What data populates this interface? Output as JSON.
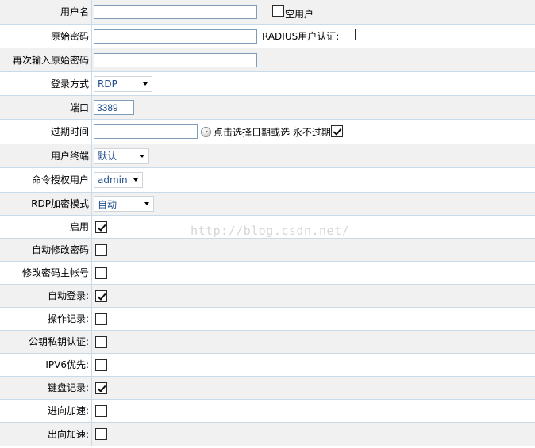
{
  "form": {
    "username": {
      "label": "用户名",
      "value": "",
      "empty_user_label": "空用户",
      "empty_user_checked": false
    },
    "orig_password": {
      "label": "原始密码",
      "value": "",
      "radius_label": "RADIUS用户认证:",
      "radius_checked": false
    },
    "confirm_password": {
      "label": "再次输入原始密码",
      "value": ""
    },
    "login_method": {
      "label": "登录方式",
      "selected": "RDP"
    },
    "port": {
      "label": "端口",
      "value": "3389"
    },
    "expire": {
      "label": "过期时间",
      "value": "",
      "hint": "点击选择日期或选 永不过期",
      "never_checked": true
    },
    "terminal": {
      "label": "用户终端",
      "selected": "默认"
    },
    "cmd_user": {
      "label": "命令授权用户",
      "selected": "admin"
    },
    "rdp_encrypt": {
      "label": "RDP加密模式",
      "selected": "自动"
    },
    "checks": [
      {
        "label": "启用",
        "checked": true
      },
      {
        "label": "自动修改密码",
        "checked": false
      },
      {
        "label": "修改密码主帐号",
        "checked": false
      },
      {
        "label": "自动登录:",
        "checked": true
      },
      {
        "label": "操作记录:",
        "checked": false
      },
      {
        "label": "公钥私钥认证:",
        "checked": false
      },
      {
        "label": "IPV6优先:",
        "checked": false
      },
      {
        "label": "键盘记录:",
        "checked": true
      },
      {
        "label": "进向加速:",
        "checked": false
      },
      {
        "label": "出向加速:",
        "checked": false
      }
    ]
  },
  "icons": {
    "calendar": "calendar-clock-icon"
  },
  "watermark": "http://blog.csdn.net/",
  "colors": {
    "row_alt": "#f1f1f1",
    "grid_line": "#c9dbe9",
    "select_text": "#1f4e8c",
    "input_border": "#7f9db9"
  }
}
